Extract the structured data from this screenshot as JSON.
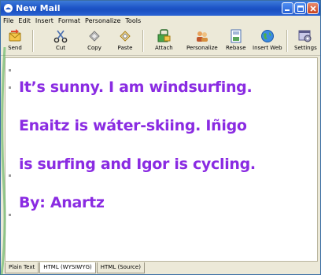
{
  "window": {
    "title": "New Mail"
  },
  "menu": [
    "File",
    "Edit",
    "Insert",
    "Format",
    "Personalize",
    "Tools"
  ],
  "toolbar": [
    {
      "label": "Send",
      "icon": "send-icon"
    },
    {
      "label": "Cut",
      "icon": "scissors-icon"
    },
    {
      "label": "Copy",
      "icon": "copy-icon"
    },
    {
      "label": "Paste",
      "icon": "paste-icon"
    },
    {
      "label": "Attach",
      "icon": "attach-icon"
    },
    {
      "label": "Personalize",
      "icon": "personalize-icon"
    },
    {
      "label": "Rebase",
      "icon": "rebase-icon"
    },
    {
      "label": "Insert Web",
      "icon": "globe-icon"
    },
    {
      "label": "Settings",
      "icon": "settings-icon"
    }
  ],
  "editor": {
    "lines": [
      "It’s sunny. I am windsurfing.",
      "Enaitz is wáter-skiing. Iñigo",
      "is surfing and Igor is cycling.",
      "By: Anartz"
    ],
    "text_color": "#8a2be2"
  },
  "tabs": [
    "Plain Text",
    "HTML (WYSIWYG)",
    "HTML (Source)"
  ],
  "active_tab": "HTML (WYSIWYG)"
}
